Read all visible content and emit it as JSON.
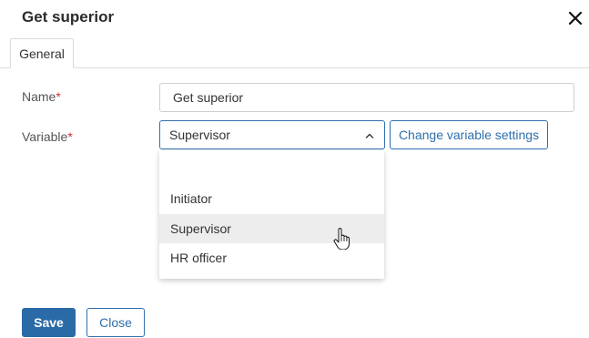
{
  "dialog": {
    "title": "Get superior",
    "close_icon": "close-icon"
  },
  "tabs": [
    {
      "label": "General",
      "active": true
    }
  ],
  "form": {
    "name": {
      "label": "Name",
      "required_mark": "*",
      "value": "Get superior"
    },
    "variable": {
      "label": "Variable",
      "required_mark": "*",
      "selected": "Supervisor",
      "chevron_icon": "chevron-up-icon",
      "options": [
        "",
        "Initiator",
        "Supervisor",
        "HR officer"
      ],
      "hovered_option": "Supervisor"
    },
    "change_settings_label": "Change variable settings"
  },
  "footer": {
    "save_label": "Save",
    "close_label": "Close"
  },
  "colors": {
    "primary": "#2a6aa6",
    "required": "#d32f2f",
    "hover_bg": "#ededed"
  },
  "cursor_icon": "hand-pointer-icon"
}
